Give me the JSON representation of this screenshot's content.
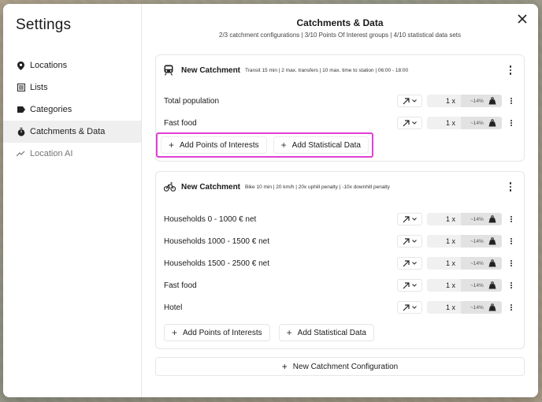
{
  "sidebar": {
    "title": "Settings",
    "items": [
      {
        "label": "Locations",
        "icon": "location-pin-icon"
      },
      {
        "label": "Lists",
        "icon": "list-icon"
      },
      {
        "label": "Categories",
        "icon": "tag-icon"
      },
      {
        "label": "Catchments & Data",
        "icon": "stopwatch-icon"
      },
      {
        "label": "Location AI",
        "icon": "trend-icon"
      }
    ]
  },
  "header": {
    "title": "Catchments & Data",
    "subtitle": "2/3 catchment configurations | 3/10 Points Of Interest groups | 4/10 statistical data sets"
  },
  "catchments": [
    {
      "name": "New Catchment",
      "mode_icon": "train-icon",
      "description": "Transit 15 min | 2 max. transfers | 10 max. time to station | 06:00 - 18:00",
      "rows": [
        {
          "label": "Total population",
          "multiplier": "1 x",
          "percent": "~14%"
        },
        {
          "label": "Fast food",
          "multiplier": "1 x",
          "percent": "~14%"
        }
      ],
      "add_poi_label": "Add Points of Interests",
      "add_stat_label": "Add Statistical Data"
    },
    {
      "name": "New Catchment",
      "mode_icon": "bicycle-icon",
      "description": "Bike 10 min | 20 km/h | 20x uphill penalty | -10x downhill penalty",
      "rows": [
        {
          "label": "Households 0 - 1000 € net",
          "multiplier": "1 x",
          "percent": "~14%"
        },
        {
          "label": "Households 1000 - 1500 € net",
          "multiplier": "1 x",
          "percent": "~14%"
        },
        {
          "label": "Households 1500 - 2500 € net",
          "multiplier": "1 x",
          "percent": "~14%"
        },
        {
          "label": "Fast food",
          "multiplier": "1 x",
          "percent": "~14%"
        },
        {
          "label": "Hotel",
          "multiplier": "1 x",
          "percent": "~14%"
        }
      ],
      "add_poi_label": "Add Points of Interests",
      "add_stat_label": "Add Statistical Data"
    }
  ],
  "new_config_label": "New Catchment Configuration",
  "colors": {
    "highlight": "#e040d8",
    "active_nav_bg": "#efefef"
  }
}
